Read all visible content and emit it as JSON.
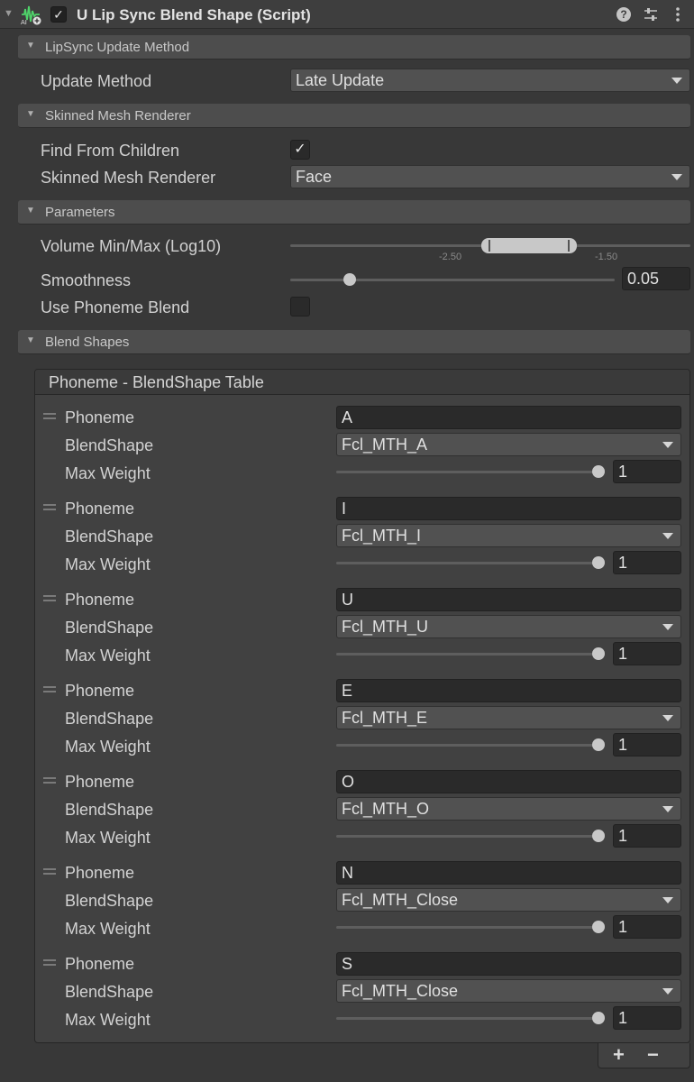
{
  "component": {
    "title": "U Lip Sync Blend Shape (Script)",
    "enabled": true,
    "icons": [
      "script-icon",
      "help-icon",
      "preset-icon",
      "context-menu-icon"
    ]
  },
  "sections": {
    "update": "LipSync Update Method",
    "renderer": "Skinned Mesh Renderer",
    "parameters": "Parameters",
    "blend": "Blend Shapes"
  },
  "update_method": {
    "label": "Update Method",
    "value": "Late Update"
  },
  "find_children": {
    "label": "Find From Children",
    "checked": true
  },
  "skinned_mesh": {
    "label": "Skinned Mesh Renderer",
    "value": "Face"
  },
  "volume": {
    "label": "Volume Min/Max (Log10)",
    "min_label": "-2.50",
    "max_label": "-1.50"
  },
  "smoothness": {
    "label": "Smoothness",
    "value": "0.05"
  },
  "phoneme_blend": {
    "label": "Use Phoneme Blend",
    "checked": false
  },
  "table": {
    "title": "Phoneme - BlendShape Table",
    "phoneme_label": "Phoneme",
    "blendshape_label": "BlendShape",
    "weight_label": "Max Weight",
    "rows": [
      {
        "phoneme": "A",
        "blendshape": "Fcl_MTH_A",
        "weight": "1"
      },
      {
        "phoneme": "I",
        "blendshape": "Fcl_MTH_I",
        "weight": "1"
      },
      {
        "phoneme": "U",
        "blendshape": "Fcl_MTH_U",
        "weight": "1"
      },
      {
        "phoneme": "E",
        "blendshape": "Fcl_MTH_E",
        "weight": "1"
      },
      {
        "phoneme": "O",
        "blendshape": "Fcl_MTH_O",
        "weight": "1"
      },
      {
        "phoneme": "N",
        "blendshape": "Fcl_MTH_Close",
        "weight": "1"
      },
      {
        "phoneme": "S",
        "blendshape": "Fcl_MTH_Close",
        "weight": "1"
      }
    ],
    "add_label": "+",
    "remove_label": "−"
  }
}
